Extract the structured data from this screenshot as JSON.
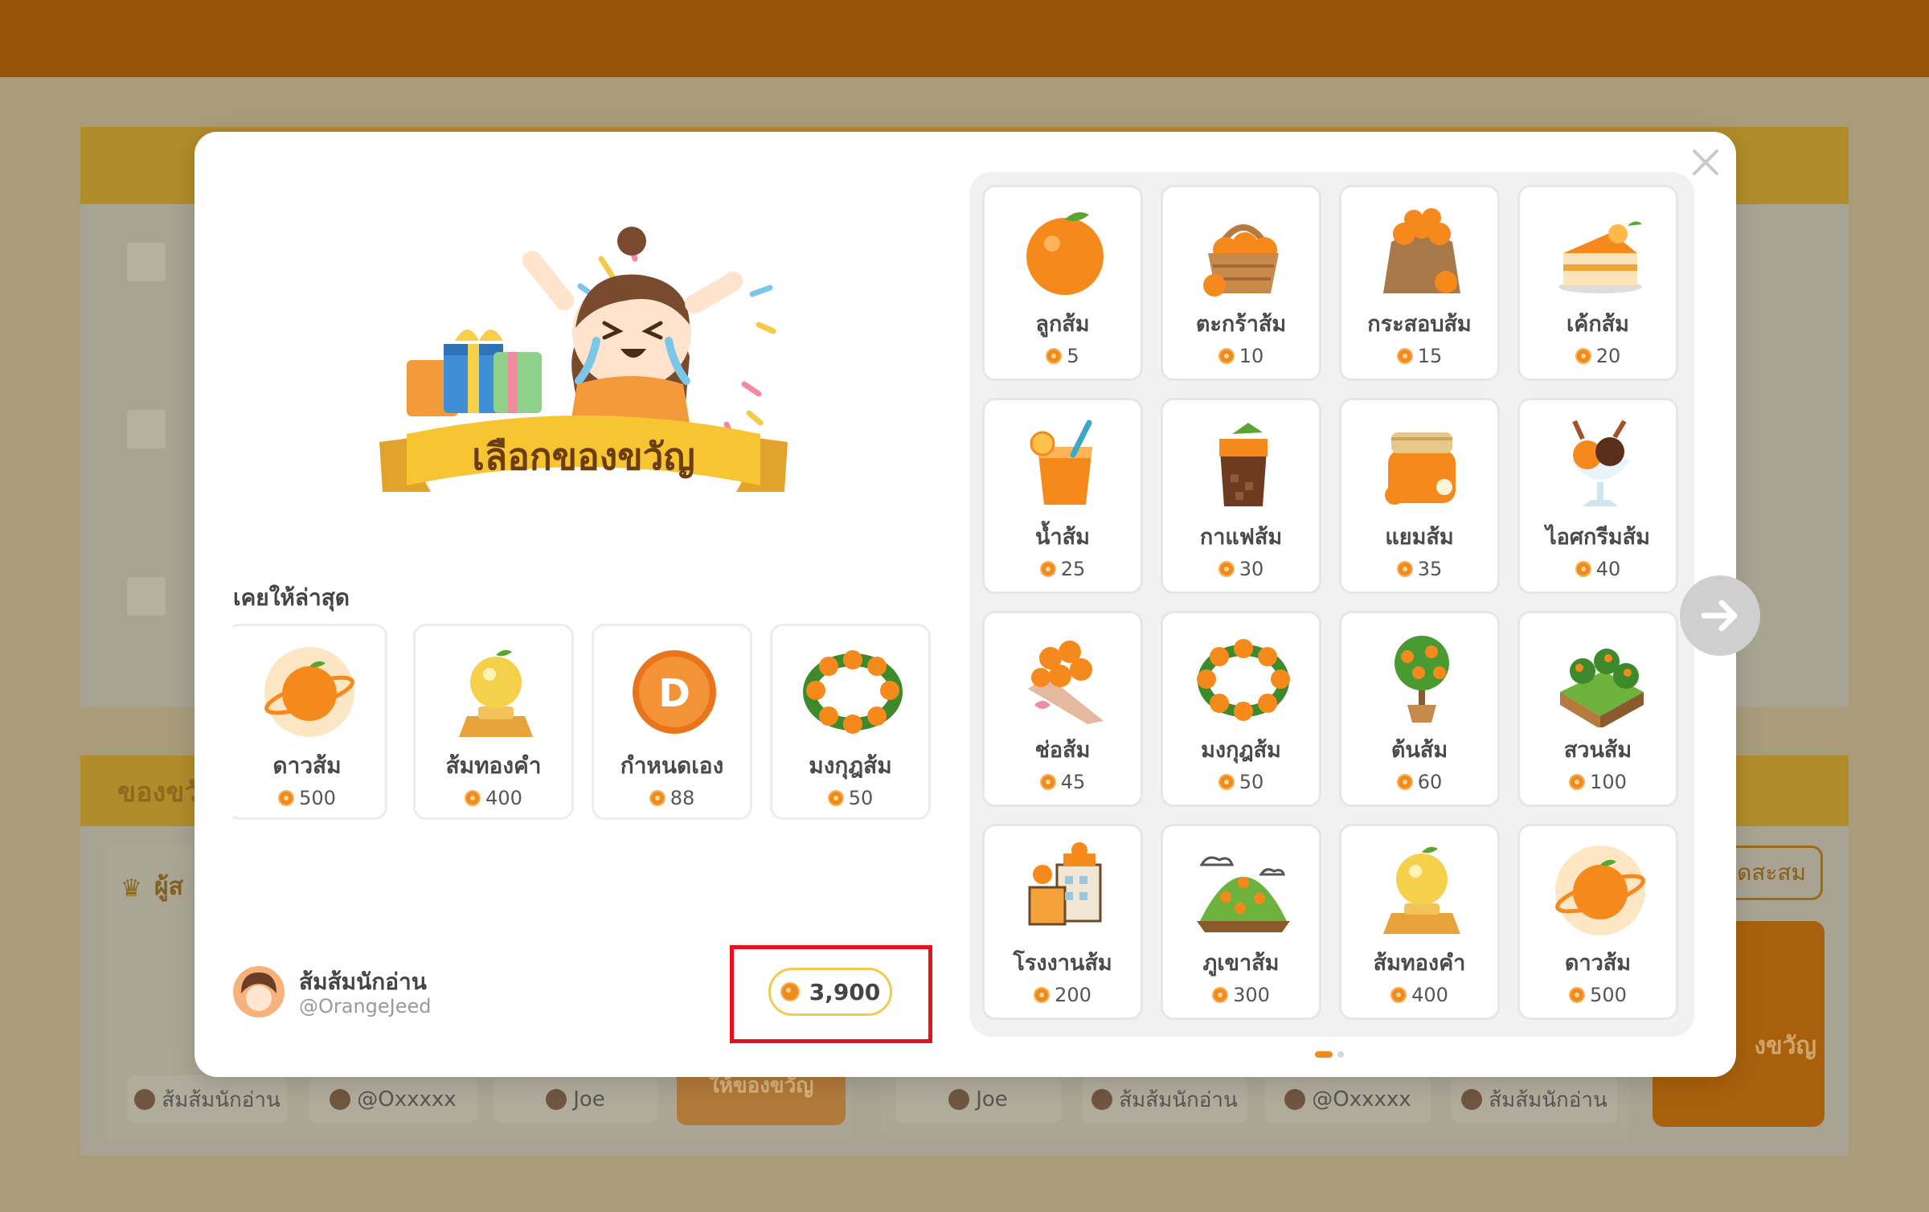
{
  "background": {
    "section_title": "ของขวัญ",
    "leaderboard_title": "ผู้ส",
    "left_chips": [
      "ส้มส้มนักอ่าน",
      "@Oxxxxx",
      "Joe"
    ],
    "left_button": "ให้ของขวัญ",
    "right_chips": [
      "Joe",
      "ส้มส้มนักอ่าน",
      "@Oxxxxx",
      "ส้มส้มนักอ่าน"
    ],
    "collect_button": "ดสะสม",
    "gift_button": "งขวัญ"
  },
  "modal": {
    "banner_text": "เลือกของขวัญ",
    "recent_title": "เคยให้ล่าสุด",
    "recent": [
      {
        "name": "ดาวส้ม",
        "price": "500",
        "icon": "orange-planet-icon"
      },
      {
        "name": "ส้มทองคำ",
        "price": "400",
        "icon": "golden-orange-trophy-icon"
      },
      {
        "name": "กำหนดเอง",
        "price": "88",
        "icon": "custom-coin-icon"
      },
      {
        "name": "มงกุฎส้ม",
        "price": "50",
        "icon": "orange-wreath-icon"
      }
    ],
    "user": {
      "name": "ส้มส้มนักอ่าน",
      "handle": "@OrangeJeed"
    },
    "balance": "3,900",
    "gifts": [
      {
        "name": "ลูกส้ม",
        "price": "5",
        "icon": "orange-icon"
      },
      {
        "name": "ตะกร้าส้ม",
        "price": "10",
        "icon": "orange-basket-icon"
      },
      {
        "name": "กระสอบส้ม",
        "price": "15",
        "icon": "orange-sack-icon"
      },
      {
        "name": "เค้กส้ม",
        "price": "20",
        "icon": "orange-cake-icon"
      },
      {
        "name": "น้ำส้ม",
        "price": "25",
        "icon": "orange-juice-icon"
      },
      {
        "name": "กาแฟส้ม",
        "price": "30",
        "icon": "orange-coffee-icon"
      },
      {
        "name": "แยมส้ม",
        "price": "35",
        "icon": "orange-jam-icon"
      },
      {
        "name": "ไอศกรีมส้ม",
        "price": "40",
        "icon": "orange-icecream-icon"
      },
      {
        "name": "ช่อส้ม",
        "price": "45",
        "icon": "orange-bouquet-icon"
      },
      {
        "name": "มงกุฎส้ม",
        "price": "50",
        "icon": "orange-wreath-icon"
      },
      {
        "name": "ต้นส้ม",
        "price": "60",
        "icon": "orange-tree-icon"
      },
      {
        "name": "สวนส้ม",
        "price": "100",
        "icon": "orange-garden-icon"
      },
      {
        "name": "โรงงานส้ม",
        "price": "200",
        "icon": "orange-factory-icon"
      },
      {
        "name": "ภูเขาส้ม",
        "price": "300",
        "icon": "orange-mountain-icon"
      },
      {
        "name": "ส้มทองคำ",
        "price": "400",
        "icon": "golden-orange-trophy-icon"
      },
      {
        "name": "ดาวส้ม",
        "price": "500",
        "icon": "orange-planet-icon"
      }
    ],
    "pagination": {
      "current": 1,
      "total": 2
    }
  },
  "colors": {
    "accent": "#f08a1c",
    "highlight": "#e8101c",
    "topbar": "#97530a"
  }
}
